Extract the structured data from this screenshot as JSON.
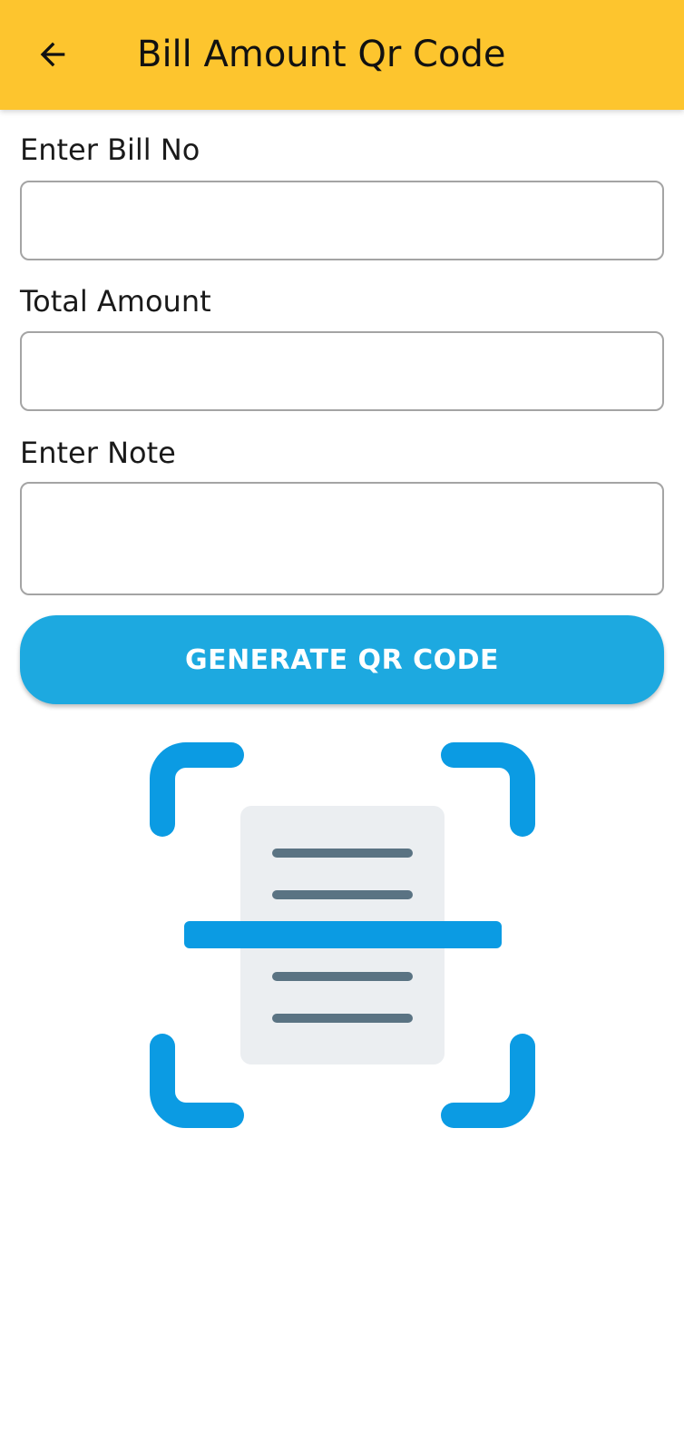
{
  "colors": {
    "appbar_bg": "#FDC52E",
    "button_bg": "#1DA9E0",
    "scan_accent": "#0B9BE3",
    "doc_bg": "#EBEEF1",
    "doc_lines": "#5A7383"
  },
  "appbar": {
    "back_icon": "arrow-left-icon",
    "title": "Bill Amount Qr Code"
  },
  "form": {
    "bill_no": {
      "label": "Enter Bill No",
      "value": "",
      "placeholder": ""
    },
    "total_amount": {
      "label": "Total Amount",
      "value": "",
      "placeholder": ""
    },
    "note": {
      "label": "Enter Note",
      "value": "",
      "placeholder": ""
    }
  },
  "generate_button": {
    "label": "GENERATE QR CODE"
  },
  "illustration": {
    "icon": "document-scan-icon"
  }
}
